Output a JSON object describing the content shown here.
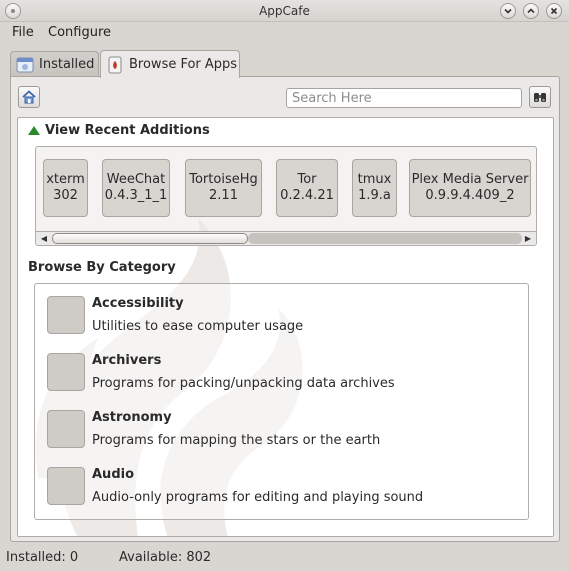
{
  "window": {
    "title": "AppCafe"
  },
  "menu": {
    "file": "File",
    "configure": "Configure"
  },
  "tabs": [
    {
      "label": "Installed"
    },
    {
      "label": "Browse For Apps"
    }
  ],
  "search": {
    "placeholder": "Search Here"
  },
  "recent": {
    "header": "View Recent Additions",
    "apps": [
      {
        "name": "xterm",
        "version": "302"
      },
      {
        "name": "WeeChat",
        "version": "0.4.3_1_1"
      },
      {
        "name": "TortoiseHg",
        "version": "2.11"
      },
      {
        "name": "Tor",
        "version": "0.2.4.21"
      },
      {
        "name": "tmux",
        "version": "1.9.a"
      },
      {
        "name": "Plex Media Server",
        "version": "0.9.9.4.409_2"
      }
    ]
  },
  "categories": {
    "header": "Browse By Category",
    "items": [
      {
        "name": "Accessibility",
        "description": "Utilities to ease computer usage"
      },
      {
        "name": "Archivers",
        "description": "Programs for packing/unpacking data archives"
      },
      {
        "name": "Astronomy",
        "description": "Programs for mapping the stars or the earth"
      },
      {
        "name": "Audio",
        "description": "Audio-only programs for editing and playing sound"
      }
    ]
  },
  "status": {
    "installed": "Installed: 0",
    "available": "Available: 802"
  },
  "icons": {
    "home": "home-icon",
    "search": "binoculars-icon",
    "recent": "triangle-up-icon"
  },
  "colors": {
    "accent_green": "#2a8a2a",
    "window_bg": "#d9d6d2"
  }
}
